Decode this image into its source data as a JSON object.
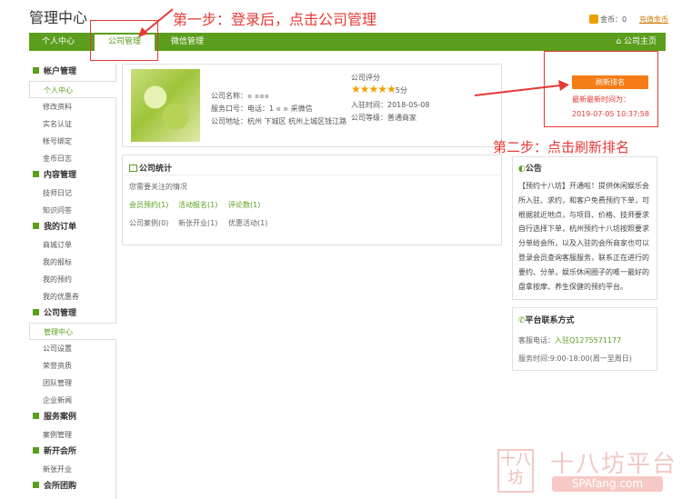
{
  "header": {
    "title": "管理中心",
    "coins_label": "金币：0",
    "recharge_link": "充值金币"
  },
  "nav": {
    "items": [
      "个人中心",
      "公司管理",
      "微信管理"
    ],
    "active_index": 1,
    "home_link": "公司主页"
  },
  "annotations": {
    "step1": "第一步：登录后，点击公司管理",
    "step2": "第二步：点击刷新排名"
  },
  "sidebar": {
    "groups": [
      {
        "title": "帐户管理",
        "items": [
          "个人中心",
          "修改资料",
          "实名认证",
          "帐号绑定",
          "金币日志"
        ]
      },
      {
        "title": "内容管理",
        "items": [
          "技师日记",
          "知识问答"
        ]
      },
      {
        "title": "我的订单",
        "items": [
          "商城订单",
          "我的报标",
          "我的预约",
          "我的优惠券"
        ]
      },
      {
        "title": "公司管理",
        "items": [
          "管理中心",
          "公司设置",
          "荣誉资质",
          "团队管理",
          "企业新闻"
        ]
      },
      {
        "title": "服务案例",
        "items": [
          "案例管理"
        ]
      },
      {
        "title": "新开会所",
        "items": [
          "新张开业"
        ]
      },
      {
        "title": "会所团购",
        "items": []
      }
    ],
    "active_item": "管理中心"
  },
  "company": {
    "name_label": "公司名称：",
    "service_label": "服务口号：电话：1",
    "service_tail": "采微信",
    "address_label": "公司地址：杭州 下城区 杭州上城区钱江路",
    "rating_label": "公司评分",
    "rating_value": "5分",
    "rating_stars": 5,
    "join_time": "入驻时间：2018-05-08",
    "level": "公司等级：普通商家",
    "refresh_button": "刷新排名",
    "last_refresh_label": "最新最新时间为：",
    "last_refresh_time": "2019-07-05 10:37:58"
  },
  "stats": {
    "title": "公司统计",
    "subtitle": "您需要关注的情况",
    "row1": [
      "会员预约(1)",
      "活动报名(1)",
      "评论数(1)"
    ],
    "row2": [
      "公司案例(0)",
      "新张开业(1)",
      "优惠活动(1)"
    ]
  },
  "notice": {
    "title": "公告",
    "body": "【预约十八坊】开通啦！提供休闲娱乐会所入驻、求约，和客户免费预约下单，可根据就近地点，与项目、价格、技师要求自行选择下单，杭州预约十八坊按照要求分单给会所，以及入驻的会所商家也可以登录会员查询客服服务，联系正在进行的要约、分单，娱乐休闲圈子的唯一最好的盘拿按摩、养生保健的预约平台。"
  },
  "contact": {
    "title": "平台联系方式",
    "phone_label": "客服电话：",
    "phone_link": "入驻Q1275571177",
    "hours": "服务时间:9:00-18:00(周一至周日)"
  },
  "watermark": {
    "seal": "十八坊",
    "name": "十八坊平台",
    "url": "SPAfang.com"
  },
  "colors": {
    "brand_green": "#5b9e1e",
    "accent_orange": "#f57c16",
    "annotation_red": "#e53935"
  }
}
